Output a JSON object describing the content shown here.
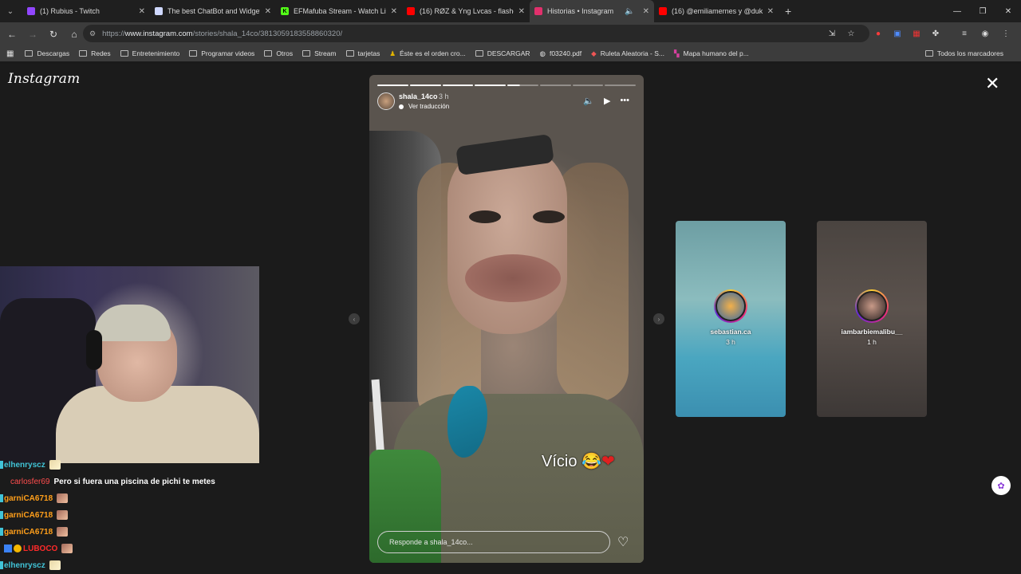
{
  "tabs": [
    {
      "title": "(1) Rubius - Twitch",
      "favicon_color": "#9146ff",
      "active": false
    },
    {
      "title": "The best ChatBot and Widgets",
      "favicon_color": "#cfd8ff",
      "active": false
    },
    {
      "title": "EFMafuba Stream - Watch Live",
      "favicon_color": "#53fc18",
      "active": false
    },
    {
      "title": "(16) RØZ & Yng Lvcas - flashes",
      "favicon_color": "#ff0000",
      "active": false
    },
    {
      "title": "Historias • Instagram",
      "favicon_color": "#e1306c",
      "active": true
    },
    {
      "title": "(16) @emiliamernes y @duki e",
      "favicon_color": "#ff0000",
      "active": false
    }
  ],
  "address": {
    "scheme": "https://",
    "host": "www.instagram.com",
    "path": "/stories/shala_14co/3813059183558860320/"
  },
  "bookmarks": [
    "Descargas",
    "Redes",
    "Entretenimiento",
    "Programar videos",
    "Otros",
    "Stream",
    "tarjetas",
    "Éste es el orden cro...",
    "DESCARGAR",
    "f03240.pdf",
    "Ruleta Aleatoria - S...",
    "Mapa humano del p..."
  ],
  "all_bookmarks": "Todos los marcadores",
  "instagram": {
    "logo": "Instagram",
    "story": {
      "username": "shala_14co",
      "time": "3 h",
      "translate": "Ver traducción",
      "caption_word": "Vício",
      "caption_emoji": "😂",
      "caption_heart": "❤",
      "reply_placeholder": "Responde a shala_14co...",
      "progress_total": 8,
      "progress_done": 4,
      "progress_current_fraction": 0.4
    },
    "next_stories": [
      {
        "name": "sebastian.ca",
        "time": "3 h"
      },
      {
        "name": "iambarbiemalibu__",
        "time": "1 h"
      }
    ]
  },
  "chat": [
    {
      "user": "elhenryscz",
      "color": "#41c4d8",
      "message": ""
    },
    {
      "user": "carlosfer69",
      "color": "#ff4d4d",
      "message": "Pero si fuera una piscina de pichi te metes"
    },
    {
      "user": "garniCA6718",
      "color": "#ff9f1a",
      "message": ""
    },
    {
      "user": "garniCA6718",
      "color": "#ff9f1a",
      "message": ""
    },
    {
      "user": "garniCA6718",
      "color": "#ff9f1a",
      "message": ""
    },
    {
      "user": "LUBOCO",
      "color": "#ff2a2a",
      "message": ""
    },
    {
      "user": "elhenryscz",
      "color": "#41c4d8",
      "message": ""
    }
  ]
}
